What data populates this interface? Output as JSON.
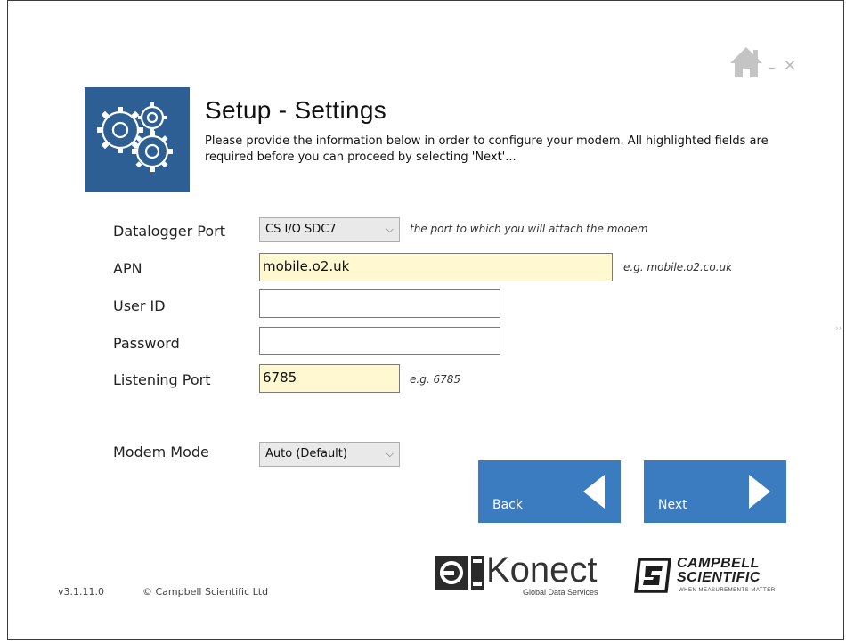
{
  "window": {
    "home_icon": "home-icon",
    "minimize": "–",
    "close": "×",
    "side_arrows": "››"
  },
  "header": {
    "icon": "gears-icon",
    "title": "Setup - Settings",
    "description": "Please provide the information below in order to configure your modem.  All highlighted fields are required before you can proceed by selecting 'Next'..."
  },
  "form": {
    "datalogger_port": {
      "label": "Datalogger Port",
      "value": "CS I/O SDC7",
      "hint": "the port to which you will attach the modem"
    },
    "apn": {
      "label": "APN",
      "value": "mobile.o2.uk",
      "hint": "e.g. mobile.o2.co.uk"
    },
    "user_id": {
      "label": "User ID",
      "value": ""
    },
    "password": {
      "label": "Password",
      "value": ""
    },
    "listening_port": {
      "label": "Listening Port",
      "value": "6785",
      "hint": "e.g. 6785"
    },
    "modem_mode": {
      "label": "Modem Mode",
      "value": "Auto (Default)"
    }
  },
  "nav": {
    "back_label": "Back",
    "next_label": "Next"
  },
  "footer": {
    "version": "v3.1.11.0",
    "copyright": "© Campbell Scientific Ltd",
    "konect": {
      "name": "Konect",
      "tagline": "Global Data Services"
    },
    "campbell": {
      "line1": "CAMPBELL",
      "line2": "SCIENTIFIC",
      "tagline": "WHEN MEASUREMENTS MATTER"
    }
  },
  "colors": {
    "tile": "#2d5f94",
    "nav_button": "#3a7cbf",
    "required_field": "#fff8d0"
  }
}
